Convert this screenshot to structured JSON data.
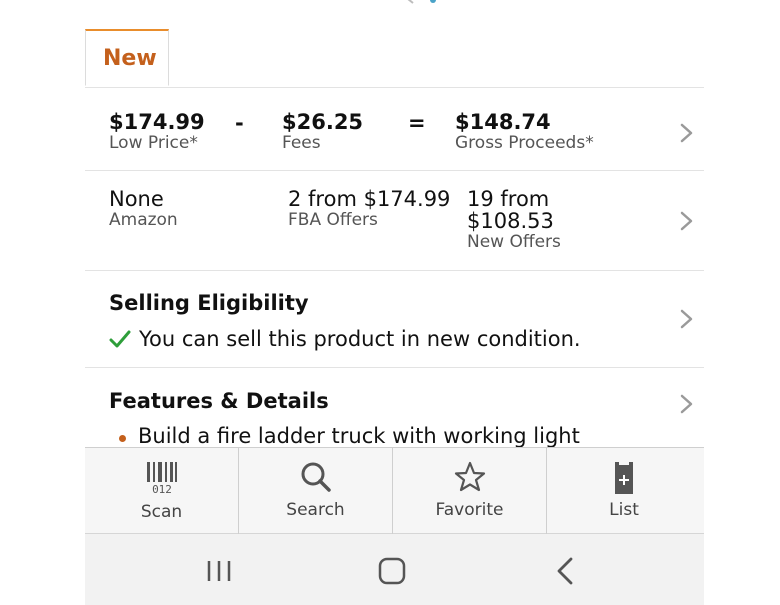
{
  "tabs": [
    {
      "label": "New"
    }
  ],
  "profit": {
    "low_price": {
      "value": "$174.99",
      "label": "Low Price*"
    },
    "minus": "-",
    "fees": {
      "value": "$26.25",
      "label": "Fees"
    },
    "equals": "=",
    "gross": {
      "value": "$148.74",
      "label": "Gross Proceeds*"
    }
  },
  "offers": {
    "amazon": {
      "value": "None",
      "label": "Amazon"
    },
    "fba": {
      "value": "2 from $174.99",
      "label": "FBA Offers"
    },
    "new_offers": {
      "value_line1": "19 from",
      "value_line2": "$108.53",
      "label": "New Offers"
    }
  },
  "eligibility": {
    "heading": "Selling Eligibility",
    "status": "You can sell this product in new condition.",
    "status_color": "#2e9e3a"
  },
  "features": {
    "heading": "Features & Details",
    "items": [
      "Build a fire ladder truck with working light"
    ]
  },
  "bottom_nav": [
    {
      "label": "Scan",
      "icon": "barcode-scan-icon",
      "barcode_digits": "012"
    },
    {
      "label": "Search",
      "icon": "search-icon"
    },
    {
      "label": "Favorite",
      "icon": "star-icon"
    },
    {
      "label": "List",
      "icon": "list-add-icon"
    }
  ],
  "colors": {
    "accent": "#c4601c",
    "tab_top_border": "#e98d2c",
    "check": "#2e9e3a"
  }
}
